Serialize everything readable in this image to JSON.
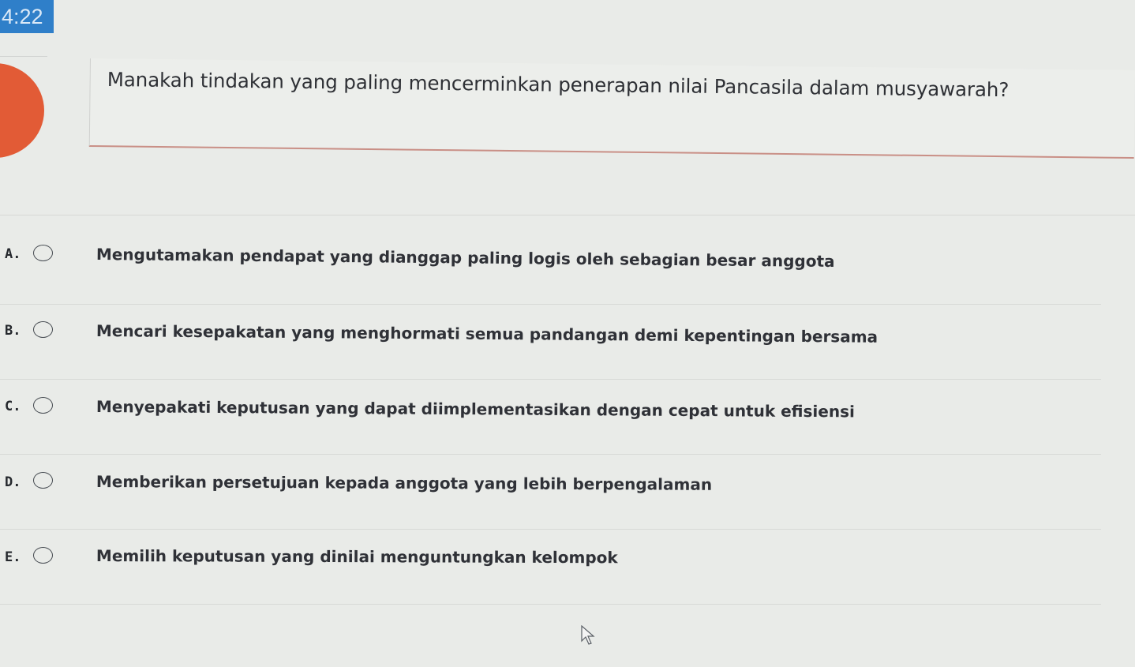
{
  "timer": {
    "text": "4:22"
  },
  "question": {
    "text": "Manakah tindakan yang paling mencerminkan penerapan nilai Pancasila dalam musyawarah?"
  },
  "answers": [
    {
      "letter": "A.",
      "text": "Mengutamakan pendapat yang dianggap paling logis oleh sebagian besar anggota"
    },
    {
      "letter": "B.",
      "text": "Mencari kesepakatan yang menghormati semua pandangan demi kepentingan bersama"
    },
    {
      "letter": "C.",
      "text": "Menyepakati keputusan yang dapat diimplementasikan dengan cepat untuk efisiensi"
    },
    {
      "letter": "D.",
      "text": "Memberikan persetujuan kepada anggota yang lebih berpengalaman"
    },
    {
      "letter": "E.",
      "text": "Memilih keputusan yang dinilai menguntungkan kelompok"
    }
  ],
  "colors": {
    "timer_background": "#2f7fc9",
    "question_number_badge": "#e25b36",
    "question_divider": "#c98f86",
    "background": "#e9ebe8"
  }
}
